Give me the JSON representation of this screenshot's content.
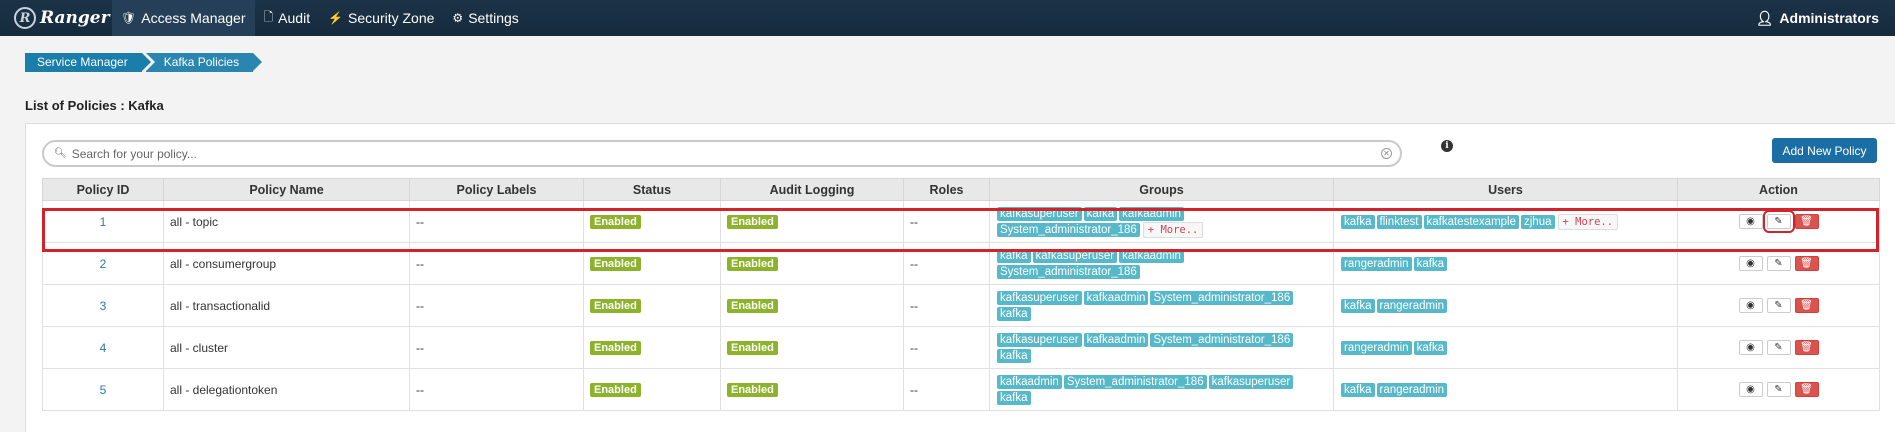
{
  "navbar": {
    "brand": "Ranger",
    "brand_logo": "R",
    "items": [
      {
        "label": "Access Manager",
        "icon": "shield-icon"
      },
      {
        "label": "Audit",
        "icon": "file-icon"
      },
      {
        "label": "Security Zone",
        "icon": "zone-icon"
      },
      {
        "label": "Settings",
        "icon": "gear-icon"
      }
    ],
    "user": "Administrators"
  },
  "breadcrumb": [
    "Service Manager",
    "Kafka Policies"
  ],
  "page_title": "List of Policies : Kafka",
  "search": {
    "placeholder": "Search for your policy..."
  },
  "add_button": "Add New Policy",
  "table": {
    "headers": [
      "Policy ID",
      "Policy Name",
      "Policy Labels",
      "Status",
      "Audit Logging",
      "Roles",
      "Groups",
      "Users",
      "Action"
    ],
    "rows": [
      {
        "id": "1",
        "name": "all - topic",
        "labels": "--",
        "status": "Enabled",
        "audit": "Enabled",
        "roles": "--",
        "groups": [
          "kafkasuperuser",
          "kafka",
          "kafkaadmin",
          "System_administrator_186"
        ],
        "groups_more": "+ More..",
        "users": [
          "kafka",
          "flinktest",
          "kafkatestexample",
          "zjhua"
        ],
        "users_more": "+ More.."
      },
      {
        "id": "2",
        "name": "all - consumergroup",
        "labels": "--",
        "status": "Enabled",
        "audit": "Enabled",
        "roles": "--",
        "groups": [
          "kafka",
          "kafkasuperuser",
          "kafkaadmin",
          "System_administrator_186"
        ],
        "users": [
          "rangeradmin",
          "kafka"
        ]
      },
      {
        "id": "3",
        "name": "all - transactionalid",
        "labels": "--",
        "status": "Enabled",
        "audit": "Enabled",
        "roles": "--",
        "groups": [
          "kafkasuperuser",
          "kafkaadmin",
          "System_administrator_186",
          "kafka"
        ],
        "users": [
          "kafka",
          "rangeradmin"
        ]
      },
      {
        "id": "4",
        "name": "all - cluster",
        "labels": "--",
        "status": "Enabled",
        "audit": "Enabled",
        "roles": "--",
        "groups": [
          "kafkasuperuser",
          "kafkaadmin",
          "System_administrator_186",
          "kafka"
        ],
        "users": [
          "rangeradmin",
          "kafka"
        ]
      },
      {
        "id": "5",
        "name": "all - delegationtoken",
        "labels": "--",
        "status": "Enabled",
        "audit": "Enabled",
        "roles": "--",
        "groups": [
          "kafkaadmin",
          "System_administrator_186",
          "kafkasuperuser",
          "kafka"
        ],
        "users": [
          "kafka",
          "rangeradmin"
        ]
      }
    ]
  },
  "colors": {
    "navbar": "#1c3348",
    "badge_green": "#8db32c",
    "label_teal": "#56b8c8",
    "delete_red": "#d9534f",
    "highlight": "#d2232a"
  }
}
